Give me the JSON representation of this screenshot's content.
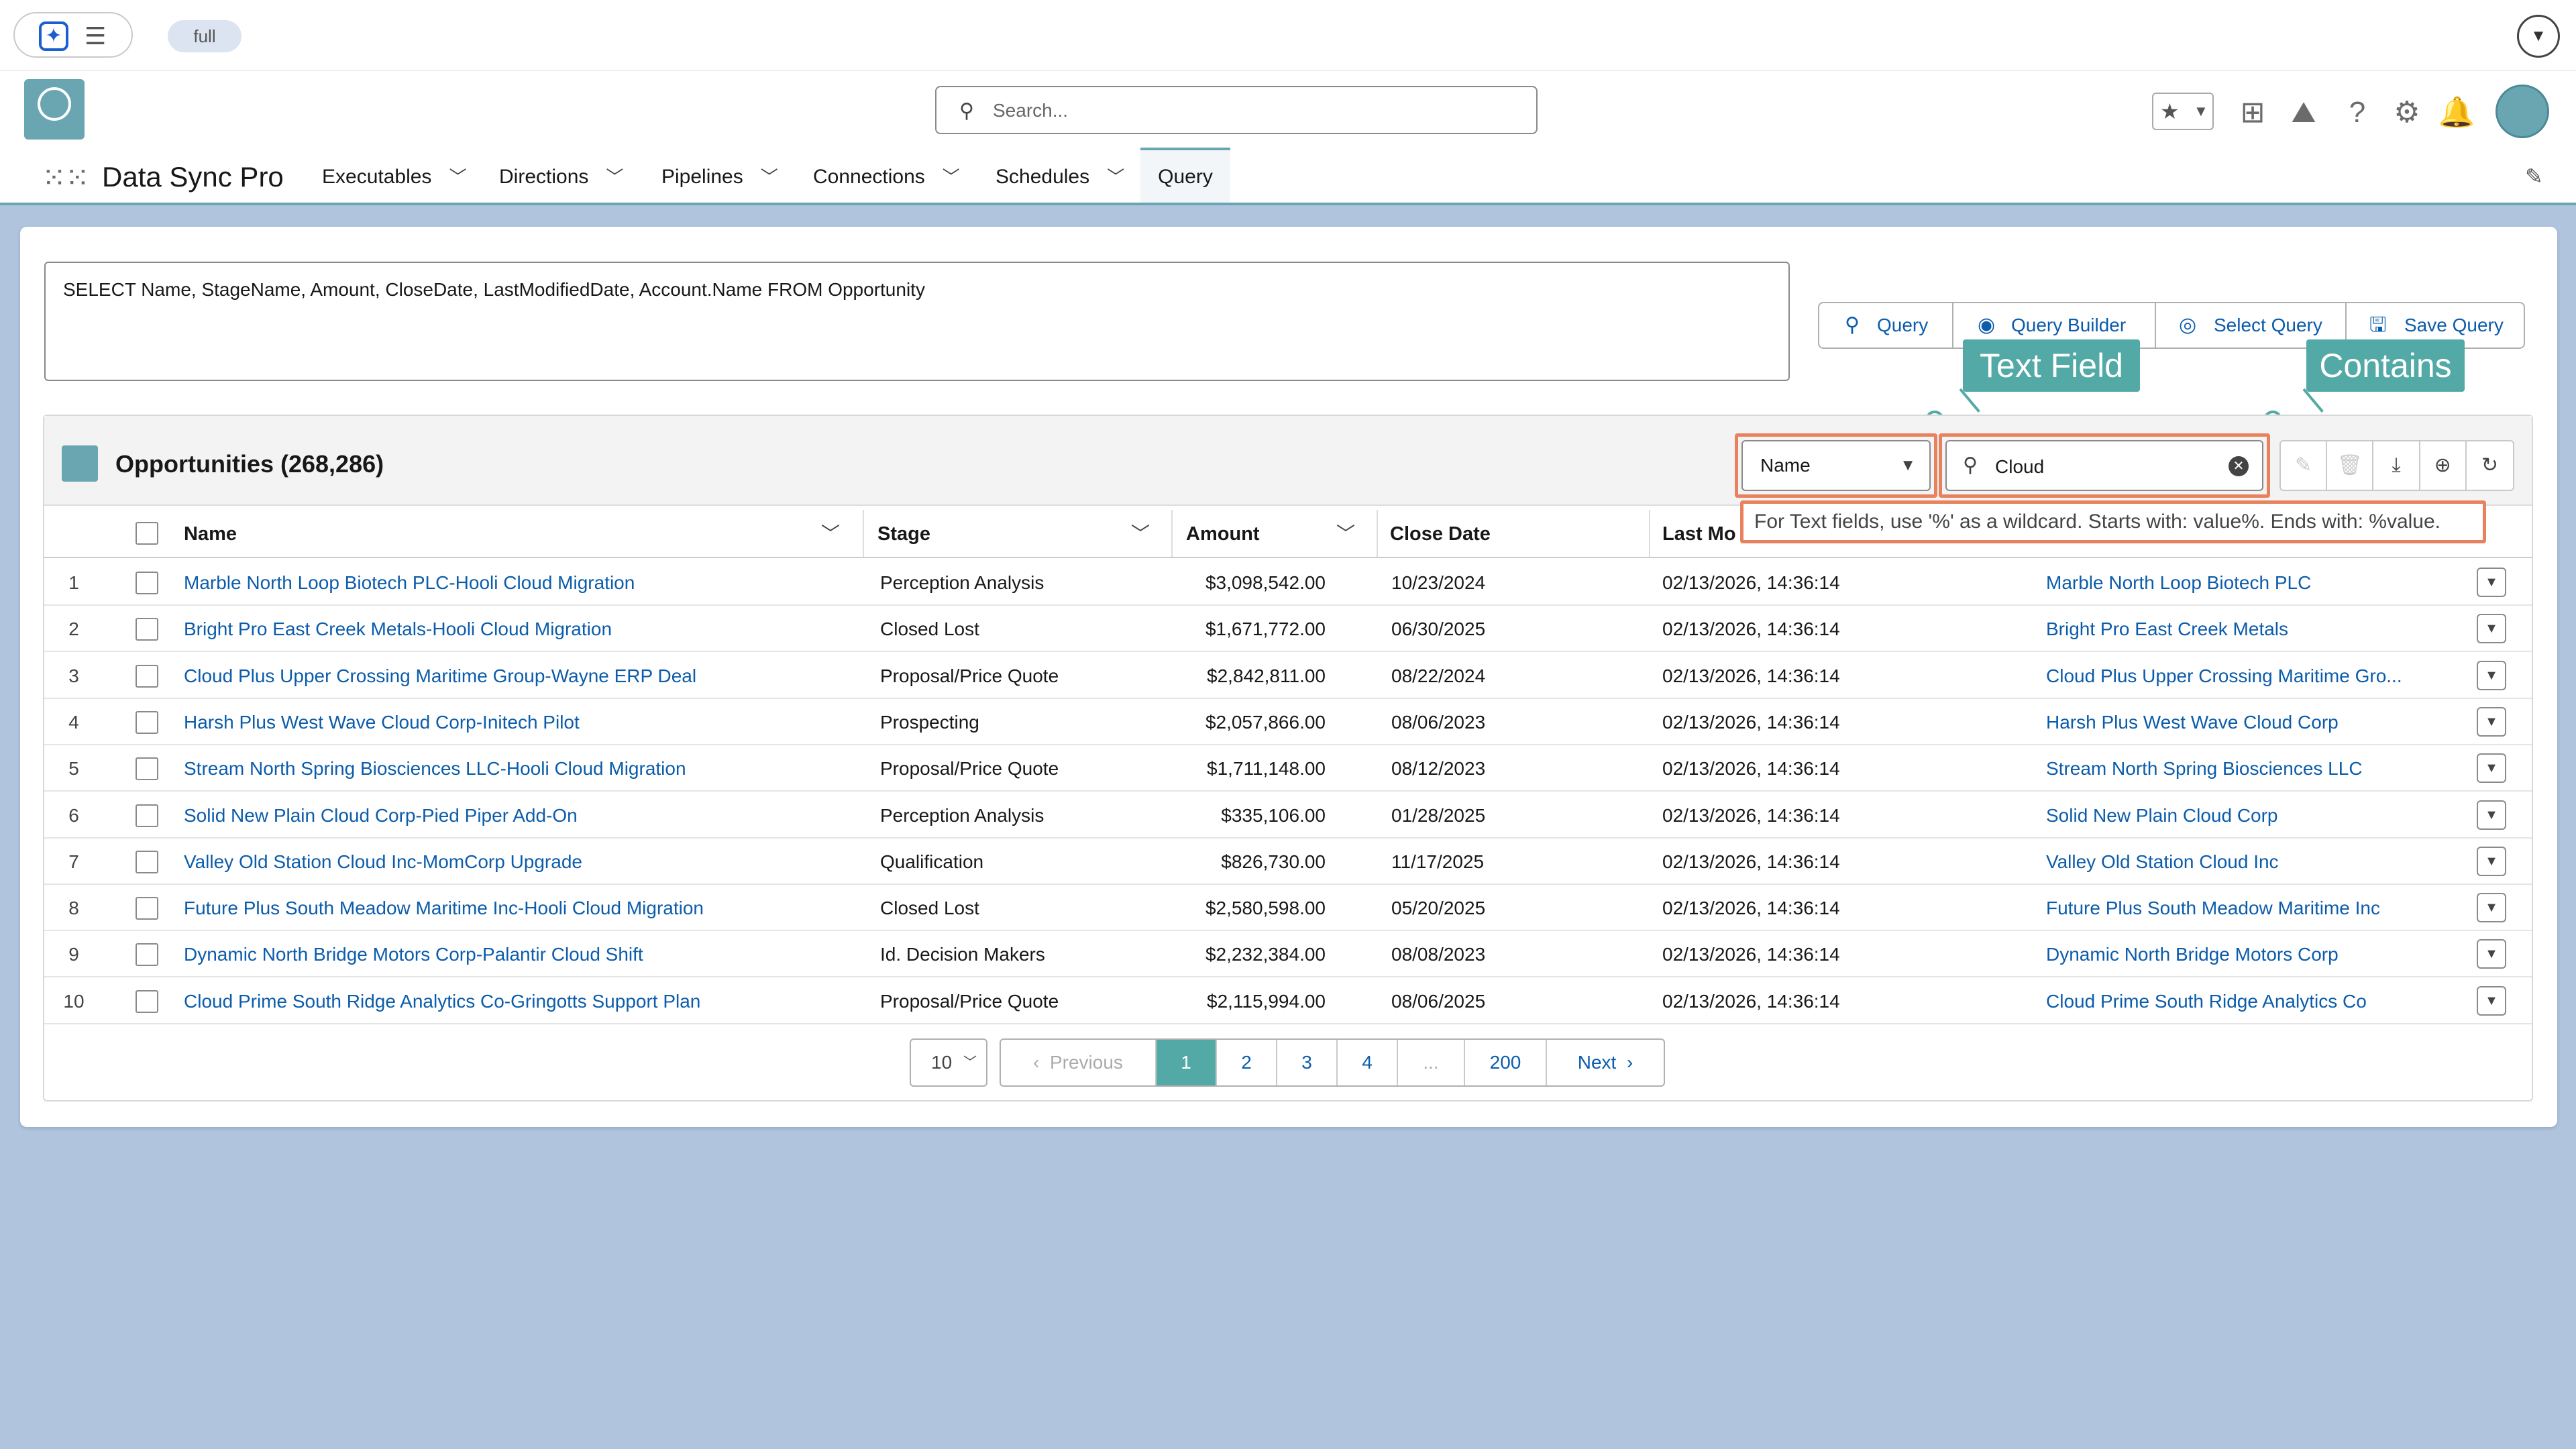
{
  "top_bar": {
    "env_label": "full"
  },
  "header": {
    "search_placeholder": "Search...",
    "app_name": "Data Sync Pro"
  },
  "nav": {
    "tabs": [
      "Executables",
      "Directions",
      "Pipelines",
      "Connections",
      "Schedules"
    ],
    "active_tab": "Query"
  },
  "query": {
    "soql": "SELECT Name, StageName, Amount, CloseDate, LastModifiedDate, Account.Name FROM Opportunity",
    "buttons": [
      "Query",
      "Query Builder",
      "Select Query",
      "Save Query"
    ]
  },
  "callouts": {
    "text_field": "Text Field",
    "contains": "Contains"
  },
  "list": {
    "title": "Opportunities (268,286)",
    "filter_field": "Name",
    "filter_value": "Cloud",
    "tooltip": "For Text fields, use '%' as a wildcard. Starts with: value%. Ends with: %value.",
    "columns": [
      "Name",
      "Stage",
      "Amount",
      "Close Date",
      "Last Mo"
    ],
    "rows": [
      {
        "n": "1",
        "name": "Marble North Loop Biotech PLC-Hooli Cloud Migration",
        "stage": "Perception Analysis",
        "amount": "$3,098,542.00",
        "close": "10/23/2024",
        "modified": "02/13/2026, 14:36:14",
        "account": "Marble North Loop Biotech PLC"
      },
      {
        "n": "2",
        "name": "Bright Pro East Creek Metals-Hooli Cloud Migration",
        "stage": "Closed Lost",
        "amount": "$1,671,772.00",
        "close": "06/30/2025",
        "modified": "02/13/2026, 14:36:14",
        "account": "Bright Pro East Creek Metals"
      },
      {
        "n": "3",
        "name": "Cloud Plus Upper Crossing Maritime Group-Wayne ERP Deal",
        "stage": "Proposal/Price Quote",
        "amount": "$2,842,811.00",
        "close": "08/22/2024",
        "modified": "02/13/2026, 14:36:14",
        "account": "Cloud Plus Upper Crossing Maritime Gro..."
      },
      {
        "n": "4",
        "name": "Harsh Plus West Wave Cloud Corp-Initech Pilot",
        "stage": "Prospecting",
        "amount": "$2,057,866.00",
        "close": "08/06/2023",
        "modified": "02/13/2026, 14:36:14",
        "account": "Harsh Plus West Wave Cloud Corp"
      },
      {
        "n": "5",
        "name": "Stream North Spring Biosciences LLC-Hooli Cloud Migration",
        "stage": "Proposal/Price Quote",
        "amount": "$1,711,148.00",
        "close": "08/12/2023",
        "modified": "02/13/2026, 14:36:14",
        "account": "Stream North Spring Biosciences LLC"
      },
      {
        "n": "6",
        "name": "Solid New Plain Cloud Corp-Pied Piper Add-On",
        "stage": "Perception Analysis",
        "amount": "$335,106.00",
        "close": "01/28/2025",
        "modified": "02/13/2026, 14:36:14",
        "account": "Solid New Plain Cloud Corp"
      },
      {
        "n": "7",
        "name": "Valley Old Station Cloud Inc-MomCorp Upgrade",
        "stage": "Qualification",
        "amount": "$826,730.00",
        "close": "11/17/2025",
        "modified": "02/13/2026, 14:36:14",
        "account": "Valley Old Station Cloud Inc"
      },
      {
        "n": "8",
        "name": "Future Plus South Meadow Maritime Inc-Hooli Cloud Migration",
        "stage": "Closed Lost",
        "amount": "$2,580,598.00",
        "close": "05/20/2025",
        "modified": "02/13/2026, 14:36:14",
        "account": "Future Plus South Meadow Maritime Inc"
      },
      {
        "n": "9",
        "name": "Dynamic North Bridge Motors Corp-Palantir Cloud Shift",
        "stage": "Id. Decision Makers",
        "amount": "$2,232,384.00",
        "close": "08/08/2023",
        "modified": "02/13/2026, 14:36:14",
        "account": "Dynamic North Bridge Motors Corp"
      },
      {
        "n": "10",
        "name": "Cloud Prime South Ridge Analytics Co-Gringotts Support Plan",
        "stage": "Proposal/Price Quote",
        "amount": "$2,115,994.00",
        "close": "08/06/2025",
        "modified": "02/13/2026, 14:36:14",
        "account": "Cloud Prime South Ridge Analytics Co"
      }
    ]
  },
  "pagination": {
    "page_size": "10",
    "previous": "Previous",
    "pages": [
      "1",
      "2",
      "3",
      "4",
      "...",
      "200"
    ],
    "current": "1",
    "next": "Next"
  },
  "colors": {
    "accent": "#53a9a5",
    "link": "#0b5cab",
    "highlight": "#e8825e",
    "background": "#b0c4de"
  }
}
